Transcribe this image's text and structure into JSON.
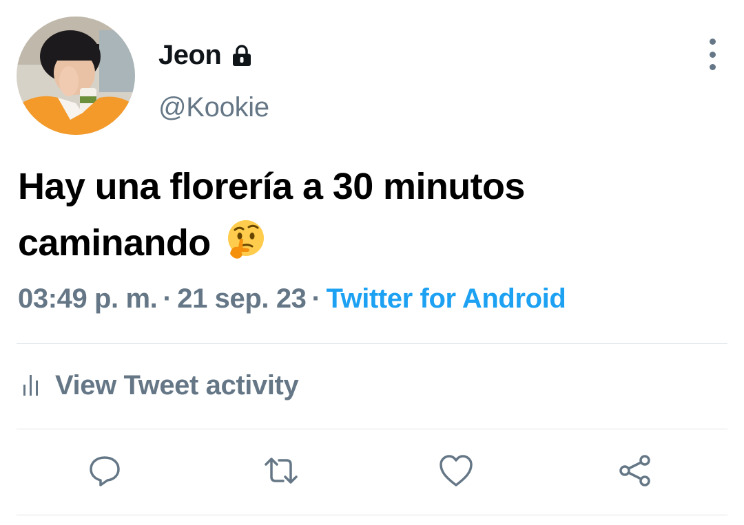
{
  "user": {
    "display_name": "Jeon",
    "handle": "@Kookie",
    "avatar_icon": "profile-photo",
    "lock_icon": "lock-icon"
  },
  "tweet": {
    "text": "Hay una florería a 30 minutos caminando",
    "emoji": "thinking-face"
  },
  "meta": {
    "time": "03:49 p. m.",
    "separator": "·",
    "date": "21 sep. 23",
    "source": "Twitter for Android"
  },
  "activity": {
    "label": "View Tweet activity",
    "icon": "bar-chart-icon"
  },
  "actions": [
    {
      "name": "reply",
      "icon": "reply-icon"
    },
    {
      "name": "retweet",
      "icon": "retweet-icon"
    },
    {
      "name": "like",
      "icon": "heart-icon"
    },
    {
      "name": "share",
      "icon": "share-icon"
    }
  ],
  "colors": {
    "accent": "#1da1f2",
    "secondary_text": "#657786",
    "primary_text": "#0f1419",
    "divider": "#dfe3e7"
  }
}
